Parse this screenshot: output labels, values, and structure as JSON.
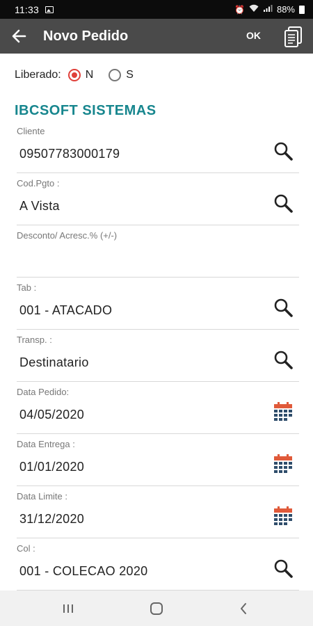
{
  "status": {
    "time": "11:33",
    "battery": "88%"
  },
  "appbar": {
    "title": "Novo Pedido",
    "ok_label": "OK"
  },
  "liberado": {
    "label": "Liberado:",
    "options": [
      {
        "label": "N",
        "selected": true
      },
      {
        "label": "S",
        "selected": false
      }
    ]
  },
  "company": "IBCSOFT SISTEMAS",
  "fields": [
    {
      "label": "Cliente",
      "value": "09507783000179",
      "icon": "search-icon"
    },
    {
      "label": "Cod.Pgto :",
      "value": "A Vista",
      "icon": "search-icon"
    },
    {
      "label": "Desconto/ Acresc.% (+/-)",
      "value": "",
      "icon": ""
    },
    {
      "label": "Tab :",
      "value": "001 - ATACADO",
      "icon": "search-icon"
    },
    {
      "label": "Transp. :",
      "value": "Destinatario",
      "icon": "search-icon"
    },
    {
      "label": "Data Pedido:",
      "value": "04/05/2020",
      "icon": "calendar-icon"
    },
    {
      "label": "Data Entrega :",
      "value": "01/01/2020",
      "icon": "calendar-icon"
    },
    {
      "label": "Data Limite :",
      "value": "31/12/2020",
      "icon": "calendar-icon"
    },
    {
      "label": "Col :",
      "value": "001 - COLECAO 2020",
      "icon": "search-icon"
    }
  ],
  "colors": {
    "accent": "#17868e",
    "radio": "#e0403a",
    "appbar": "#4a4a4a",
    "calendar_red": "#e05a3a",
    "calendar_blue": "#2f4d6b"
  }
}
